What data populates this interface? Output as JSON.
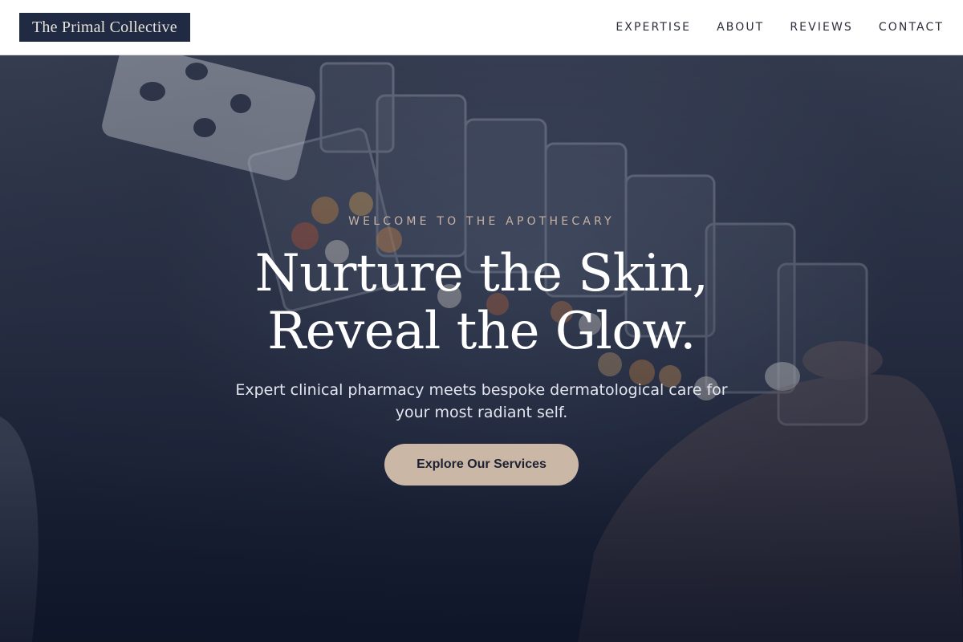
{
  "header": {
    "logo": "The Primal Collective",
    "nav": [
      {
        "label": "EXPERTISE"
      },
      {
        "label": "ABOUT"
      },
      {
        "label": "REVIEWS"
      },
      {
        "label": "CONTACT"
      }
    ]
  },
  "hero": {
    "eyebrow": "WELCOME TO THE APOTHECARY",
    "headline_line1": "Nurture the Skin,",
    "headline_line2": "Reveal the Glow.",
    "subtitle": "Expert clinical pharmacy meets bespoke dermatological care for your most radiant self.",
    "cta": "Explore Our Services",
    "background_image": "pill-organizer-photo"
  },
  "colors": {
    "logo_bg": "#202a42",
    "hero_dark": "#121a30",
    "accent": "#cbb7a6",
    "eyebrow": "#c7b2a3"
  }
}
